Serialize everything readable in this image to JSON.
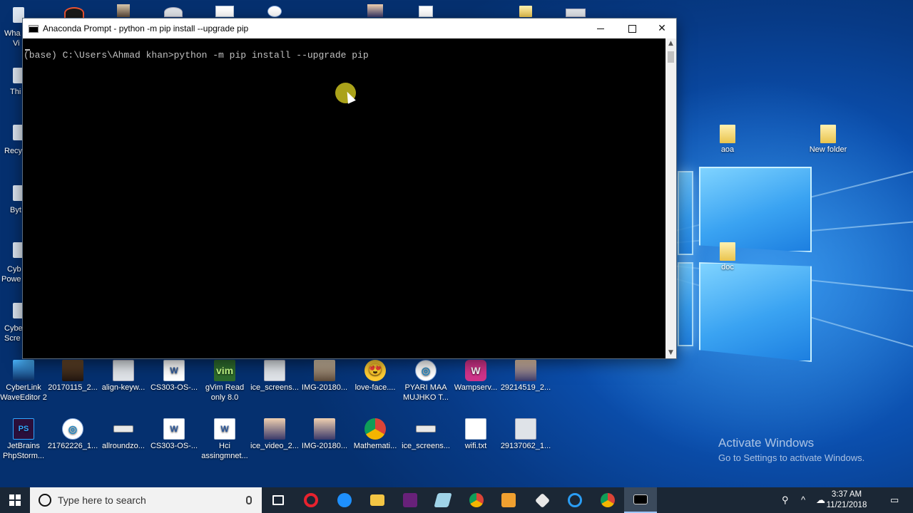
{
  "window": {
    "title": "Anaconda Prompt - python  -m pip install --upgrade pip",
    "min_symbol": "—",
    "close_symbol": "✕"
  },
  "console": {
    "prompt_line": "(base) C:\\Users\\Ahmad khan>python -m pip install --upgrade pip"
  },
  "desktop": {
    "left_column": [
      "Wha",
      "Vi",
      "Thi",
      "Recy",
      "Byt",
      "Cyb",
      "Powe",
      "Cybe",
      "Scre"
    ],
    "right_icons": [
      {
        "label": "aoa",
        "icon": "folder-icon"
      },
      {
        "label": "New folder",
        "icon": "folder-icon"
      },
      {
        "label": "doc",
        "icon": "folder-icon"
      }
    ],
    "row1": [
      {
        "label": "CyberLink WaveEditor 2",
        "icon": "wave-icon"
      },
      {
        "label": "20170115_2...",
        "icon": "image-icon"
      },
      {
        "label": "align-keyw...",
        "icon": "image-icon"
      },
      {
        "label": "CS303-OS-...",
        "icon": "word-icon"
      },
      {
        "label": "gVim Read only 8.0",
        "icon": "vim-icon"
      },
      {
        "label": "ice_screens...",
        "icon": "image-icon"
      },
      {
        "label": "IMG-20180...",
        "icon": "image-icon"
      },
      {
        "label": "love-face....",
        "icon": "emoji-icon"
      },
      {
        "label": "PYARI MAA MUJHKO T...",
        "icon": "media-icon"
      },
      {
        "label": "Wampserv...",
        "icon": "wamp-icon"
      },
      {
        "label": "29214519_2...",
        "icon": "image-icon"
      }
    ],
    "row2": [
      {
        "label": "JetBrains PhpStorm...",
        "icon": "phpstorm-icon"
      },
      {
        "label": "21762226_1...",
        "icon": "edge-file-icon"
      },
      {
        "label": "allroundzo...",
        "icon": "image-icon"
      },
      {
        "label": "CS303-OS-...",
        "icon": "word-icon"
      },
      {
        "label": "Hci assingmnet...",
        "icon": "word-icon"
      },
      {
        "label": "ice_video_2...",
        "icon": "image-icon"
      },
      {
        "label": "IMG-20180...",
        "icon": "image-icon"
      },
      {
        "label": "Mathemati...",
        "icon": "chrome-icon"
      },
      {
        "label": "ice_screens...",
        "icon": "image-icon"
      },
      {
        "label": "wifi.txt",
        "icon": "text-file-icon"
      },
      {
        "label": "29137062_1...",
        "icon": "image-icon"
      }
    ],
    "glyphs": {
      "word": "W",
      "vim": "vim",
      "ps": "PS",
      "emoji": "😍",
      "wamp": "W",
      "teal": "◎"
    }
  },
  "watermark": {
    "line1": "Activate Windows",
    "line2": "Go to Settings to activate Windows."
  },
  "taskbar": {
    "search_placeholder": "Type here to search",
    "time": "3:37 AM",
    "date": "11/21/2018"
  }
}
